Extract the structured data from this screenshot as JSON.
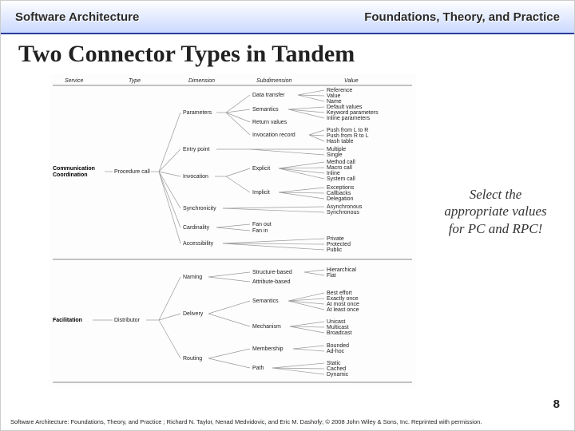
{
  "header": {
    "left": "Software Architecture",
    "right": "Foundations, Theory, and Practice"
  },
  "title": "Two Connector Types in Tandem",
  "callout": "Select the appropriate values for PC and RPC!",
  "pageno": "8",
  "footer": "Software Architecture: Foundations, Theory, and Practice ; Richard N. Taylor, Nenad Medvidovic, and Eric M. Dashofy; © 2008 John Wiley & Sons, Inc. Reprinted with permission.",
  "cols": {
    "service": "Service",
    "type": "Type",
    "dimension": "Dimension",
    "subdimension": "Subdimension",
    "value": "Value"
  },
  "serviceA": "Communication\nCoordination",
  "typeA": "Procedure call",
  "dimA": [
    "Parameters",
    "Entry point",
    "Invocation",
    "Synchronicity",
    "Cardinality",
    "Accessibility"
  ],
  "subA_param": [
    "Data transfer",
    "Semantics",
    "Return values",
    "Invocation record"
  ],
  "valA_data": [
    "Reference",
    "Value",
    "Name"
  ],
  "valA_sem": [
    "Default values",
    "Keyword parameters",
    "Inline parameters"
  ],
  "valA_inv": [
    "Push from L to R",
    "Push from R to L",
    "Hash table"
  ],
  "valA_entry": [
    "Multiple",
    "Single"
  ],
  "subA_inv": [
    "Explicit",
    "Implicit"
  ],
  "valA_exp": [
    "Method call",
    "Macro call",
    "Inline",
    "System call"
  ],
  "valA_imp": [
    "Exceptions",
    "Callbacks",
    "Delegation"
  ],
  "valA_sync": [
    "Asynchronous",
    "Synchronous"
  ],
  "valA_card": [
    "Fan out",
    "Fan in"
  ],
  "valA_acc": [
    "Private",
    "Protected",
    "Public"
  ],
  "serviceB": "Facilitation",
  "typeB": "Distributor",
  "dimB": [
    "Naming",
    "Delivery",
    "Routing"
  ],
  "subB_naming": [
    "Structure-based",
    "Attribute-based"
  ],
  "valB_naming": [
    "Hierarchical",
    "Flat"
  ],
  "subB_delivery": [
    "Semantics",
    "Mechanism"
  ],
  "valB_sem": [
    "Best effort",
    "Exactly once",
    "At most once",
    "At least once"
  ],
  "valB_mech": [
    "Unicast",
    "Multicast",
    "Broadcast"
  ],
  "subB_routing": [
    "Membership",
    "Path"
  ],
  "valB_mem": [
    "Bounded",
    "Ad-hoc"
  ],
  "valB_path": [
    "Static",
    "Cached",
    "Dynamic"
  ]
}
